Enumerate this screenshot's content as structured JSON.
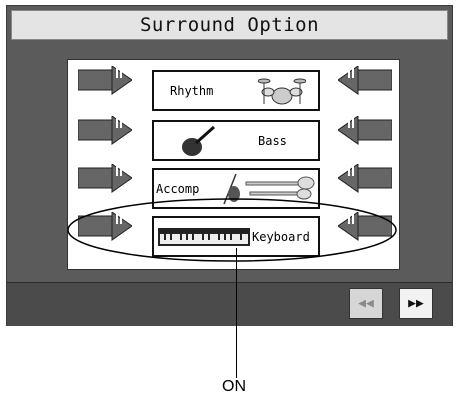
{
  "screen": {
    "title": "Surround Option"
  },
  "parts": [
    {
      "label": "Rhythm",
      "icon": "drum-kit-icon"
    },
    {
      "label": "Bass",
      "icon": "bass-instrument-icon"
    },
    {
      "label": "Accomp",
      "icon": "strings-brass-icon"
    },
    {
      "label": "Keyboard",
      "icon": "keyboard-icon"
    }
  ],
  "navigation": {
    "prev_glyph": "◀◀",
    "next_glyph": "▶▶"
  },
  "callout": {
    "label": "ON"
  }
}
